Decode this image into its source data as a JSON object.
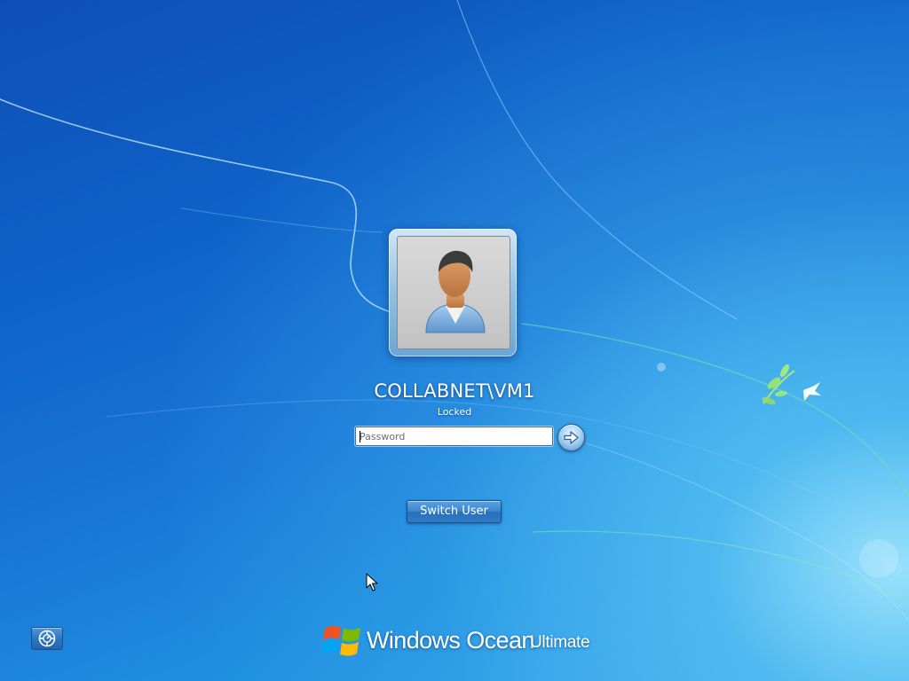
{
  "screen": {
    "type": "lock-screen"
  },
  "user": {
    "name": "COLLABNET\\VM1",
    "status": "Locked",
    "avatar_icon": "user-avatar-icon"
  },
  "password": {
    "value": "",
    "placeholder": "Password"
  },
  "submit": {
    "icon": "arrow-right-icon"
  },
  "switch_user": {
    "label": "Switch User"
  },
  "ease_of_access": {
    "icon": "ease-of-access-icon"
  },
  "branding": {
    "logo_icon": "windows-flag-icon",
    "product_name": "Windows Ocean",
    "edition": "Ultimate"
  },
  "colors": {
    "background_dark": "#0d4fb6",
    "background_light": "#3aa7ea",
    "text": "#ffffff"
  }
}
